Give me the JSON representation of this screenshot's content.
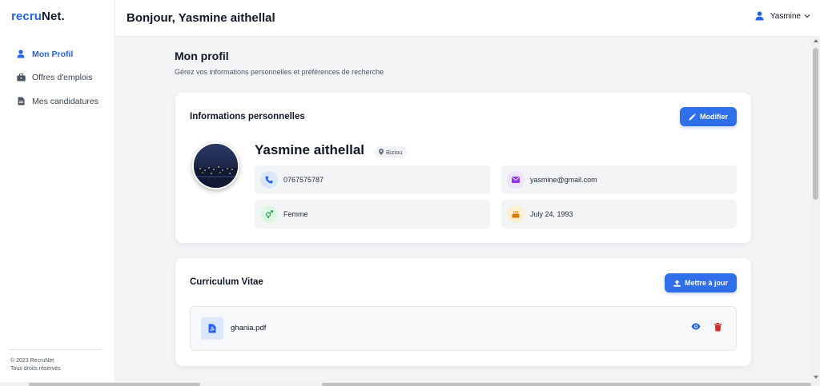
{
  "brand": {
    "part1": "recru",
    "part2": "Net."
  },
  "sidebar": {
    "items": [
      {
        "label": "Mon Profil",
        "icon": "user-icon",
        "active": true
      },
      {
        "label": "Offres d'emplois",
        "icon": "briefcase-icon",
        "active": false
      },
      {
        "label": "Mes candidatures",
        "icon": "document-icon",
        "active": false
      }
    ],
    "footer": {
      "copyright": "© 2023 RecruNet",
      "rights": "Tous droits réservés"
    }
  },
  "header": {
    "greeting": "Bonjour, Yasmine aithellal",
    "user_name": "Yasmine"
  },
  "page": {
    "title": "Mon profil",
    "subtitle": "Gérez vos informations personnelles et préférences de recherche"
  },
  "personal": {
    "title": "Informations personnelles",
    "edit_label": "Modifier",
    "name": "Yasmine aithellal",
    "location": "Biziou",
    "phone": "0767575787",
    "email": "yasmine@gmail.com",
    "gender": "Femme",
    "birthdate": "July 24, 1993"
  },
  "cv": {
    "title": "Curriculum Vitae",
    "update_label": "Mettre à jour",
    "file_name": "ghania.pdf"
  },
  "colors": {
    "accent": "#2f6fea",
    "phone_bg": "#dbe7fb",
    "email_bg": "#ede5fb",
    "gender_bg": "#dcf6e4",
    "birthday_bg": "#fcefd2",
    "delete": "#dc2626"
  }
}
